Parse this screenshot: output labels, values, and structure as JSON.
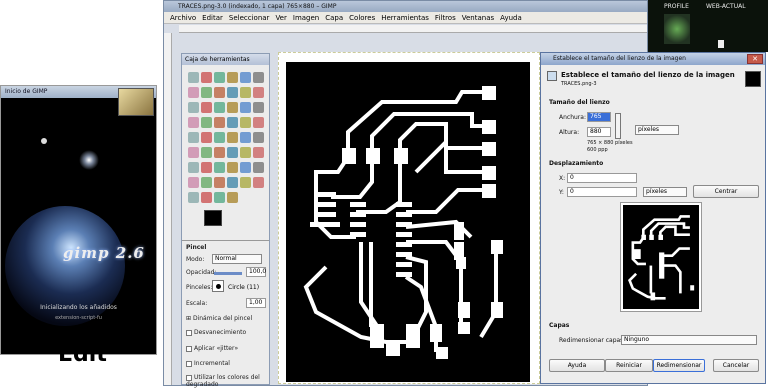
{
  "splash": {
    "title": "Inicio de GIMP",
    "version_text": "gimp 2.6",
    "status": "Inicializando los añadidos",
    "plugin": "extension-script-fu"
  },
  "caption": "Edit",
  "main_window": {
    "title": "TRACES.png-3.0 (indexado, 1 capa) 765×880 – GIMP",
    "menu": [
      "Archivo",
      "Editar",
      "Seleccionar",
      "Ver",
      "Imagen",
      "Capa",
      "Colores",
      "Herramientas",
      "Filtros",
      "Ventanas",
      "Ayuda"
    ]
  },
  "toolbox": {
    "title": "Caja de herramientas",
    "section": "Pincel",
    "modo_label": "Modo:",
    "modo_value": "Normal",
    "opacidad_label": "Opacidad:",
    "opacidad_value": "100,0",
    "pinceles_label": "Pinceles:",
    "pinceles_value": "Circle (11)",
    "escala_label": "Escala:",
    "escala_value": "1,00",
    "opts": [
      "Dinámica del pincel",
      "Desvanecimiento",
      "Aplicar «jitter»",
      "Incremental",
      "Utilizar los colores del degradado"
    ]
  },
  "dialog": {
    "title": "Establece el tamaño del lienzo de la imagen",
    "header": "Establece el tamaño del lienzo de la imagen",
    "subheader": "TRACES.png-3",
    "size_section": "Tamaño del lienzo",
    "anchura_label": "Anchura:",
    "anchura_value": "765",
    "altura_label": "Altura:",
    "altura_value": "880",
    "units": "píxeles",
    "size_info": "765 × 880 píxeles",
    "resolution": "600 ppp",
    "offset_section": "Desplazamiento",
    "x_label": "X:",
    "x_value": "0",
    "y_label": "Y:",
    "y_value": "0",
    "offset_units": "píxeles",
    "center_button": "Centrar",
    "layers_section": "Capas",
    "resize_layers_label": "Redimensionar capas:",
    "resize_layers_value": "Ninguno",
    "buttons": {
      "help": "Ayuda",
      "reset": "Reiniciar",
      "resize": "Redimensionar",
      "cancel": "Cancelar"
    }
  },
  "background": {
    "profile": "PROFILE",
    "web": "WEB-ACTUAL"
  }
}
